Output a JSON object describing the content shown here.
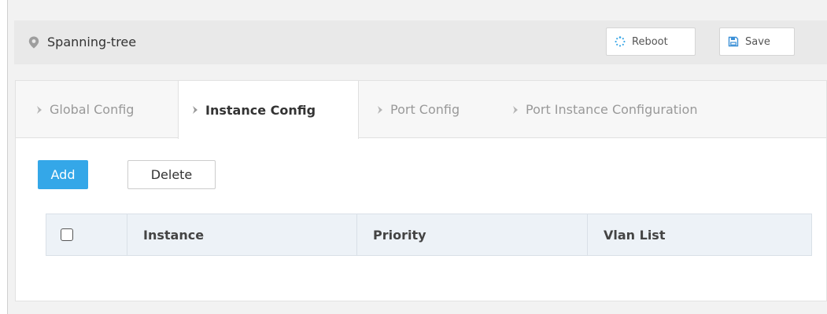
{
  "header": {
    "title": "Spanning-tree",
    "reboot_label": "Reboot",
    "save_label": "Save"
  },
  "tabs": [
    {
      "label": "Global Config",
      "active": false
    },
    {
      "label": "Instance Config",
      "active": true
    },
    {
      "label": "Port Config",
      "active": false
    },
    {
      "label": "Port Instance Configuration",
      "active": false
    }
  ],
  "actions": {
    "add_label": "Add",
    "delete_label": "Delete"
  },
  "table": {
    "columns": [
      "Instance",
      "Priority",
      "Vlan List"
    ],
    "rows": []
  },
  "icons": {
    "title": "location-pin-icon",
    "reboot": "spinner-icon",
    "save": "floppy-disk-icon",
    "tab": "chevron-right-icon"
  },
  "colors": {
    "accent": "#34a7e8",
    "header_bg": "#e9e9e9",
    "table_header_bg": "#edf2f7",
    "inactive_tab_text": "#999999"
  }
}
